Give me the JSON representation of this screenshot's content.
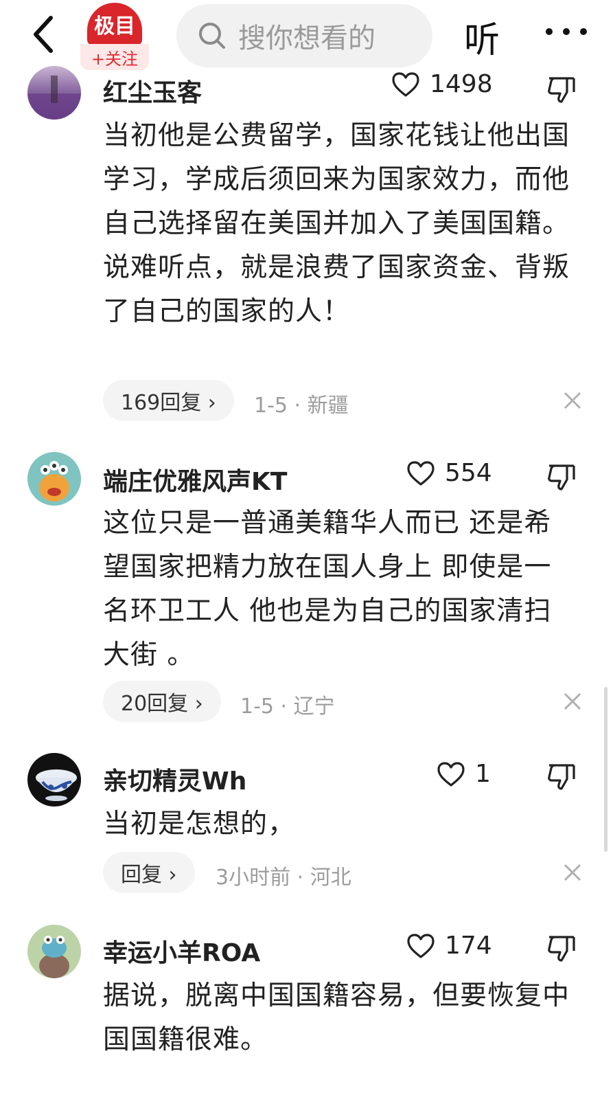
{
  "header": {
    "logo_text": "极目",
    "follow_label": "+关注",
    "search_placeholder": "搜你想看的",
    "listen_label": "听"
  },
  "comments": [
    {
      "username": "红尘玉客",
      "likes": "1498",
      "text": "当初他是公费留学，国家花钱让他出国学习，学成后须回来为国家效力，而他自己选择留在美国并加入了美国国籍。说难听点，就是浪费了国家资金、背叛了自己的国家的人！",
      "reply_label": "169回复 ›",
      "meta": "1-5 · 新疆"
    },
    {
      "username": "端庄优雅风声KT",
      "likes": "554",
      "text": "这位只是一普通美籍华人而已 还是希望国家把精力放在国人身上 即使是一名环卫工人 他也是为自己的国家清扫大街 。",
      "reply_label": "20回复 ›",
      "meta": "1-5 · 辽宁"
    },
    {
      "username": "亲切精灵Wh",
      "likes": "1",
      "text": "当初是怎想的，",
      "reply_label": "回复 ›",
      "meta": "3小时前 · 河北"
    },
    {
      "username": "幸运小羊ROA",
      "likes": "174",
      "text": "据说，脱离中国国籍容易，但要恢复中国国籍很难。"
    }
  ],
  "icons": {
    "back": "back-arrow-icon",
    "search": "search-icon",
    "more": "more-dots-icon",
    "like": "heart-icon",
    "dislike": "thumbs-down-icon",
    "close": "close-icon"
  },
  "colors": {
    "brand_red": "#d8262b",
    "meta_gray": "#9c9c9c",
    "pill_bg": "#f4f4f4"
  }
}
